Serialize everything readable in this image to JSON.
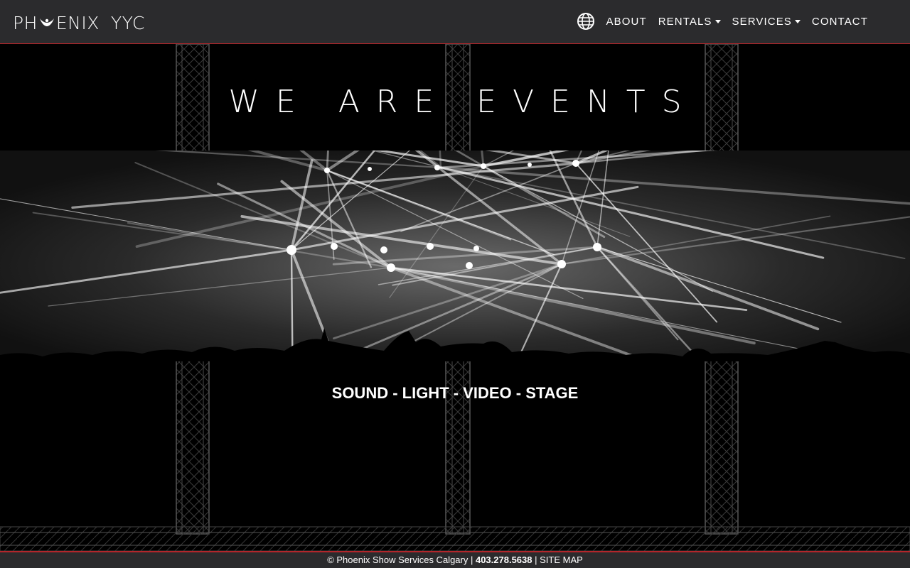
{
  "brand": {
    "logo_left": "PH",
    "logo_right": "ENIX",
    "logo_city": "YYC"
  },
  "nav": {
    "icon": "globe-icon",
    "items": [
      {
        "label": "ABOUT",
        "dropdown": false
      },
      {
        "label": "RENTALS",
        "dropdown": true
      },
      {
        "label": "SERVICES",
        "dropdown": true
      },
      {
        "label": "CONTACT",
        "dropdown": false
      }
    ]
  },
  "hero": {
    "headline": "WE ARE EVENTS",
    "tagline": "SOUND - LIGHT - VIDEO - STAGE"
  },
  "footer": {
    "copyright": "© Phoenix Show Services Calgary |",
    "phone": "403.278.5638",
    "sitemap": "| SITE MAP"
  },
  "colors": {
    "navbar_bg": "#2b2b2d",
    "accent_red": "#b3262b",
    "page_bg": "#000000"
  }
}
